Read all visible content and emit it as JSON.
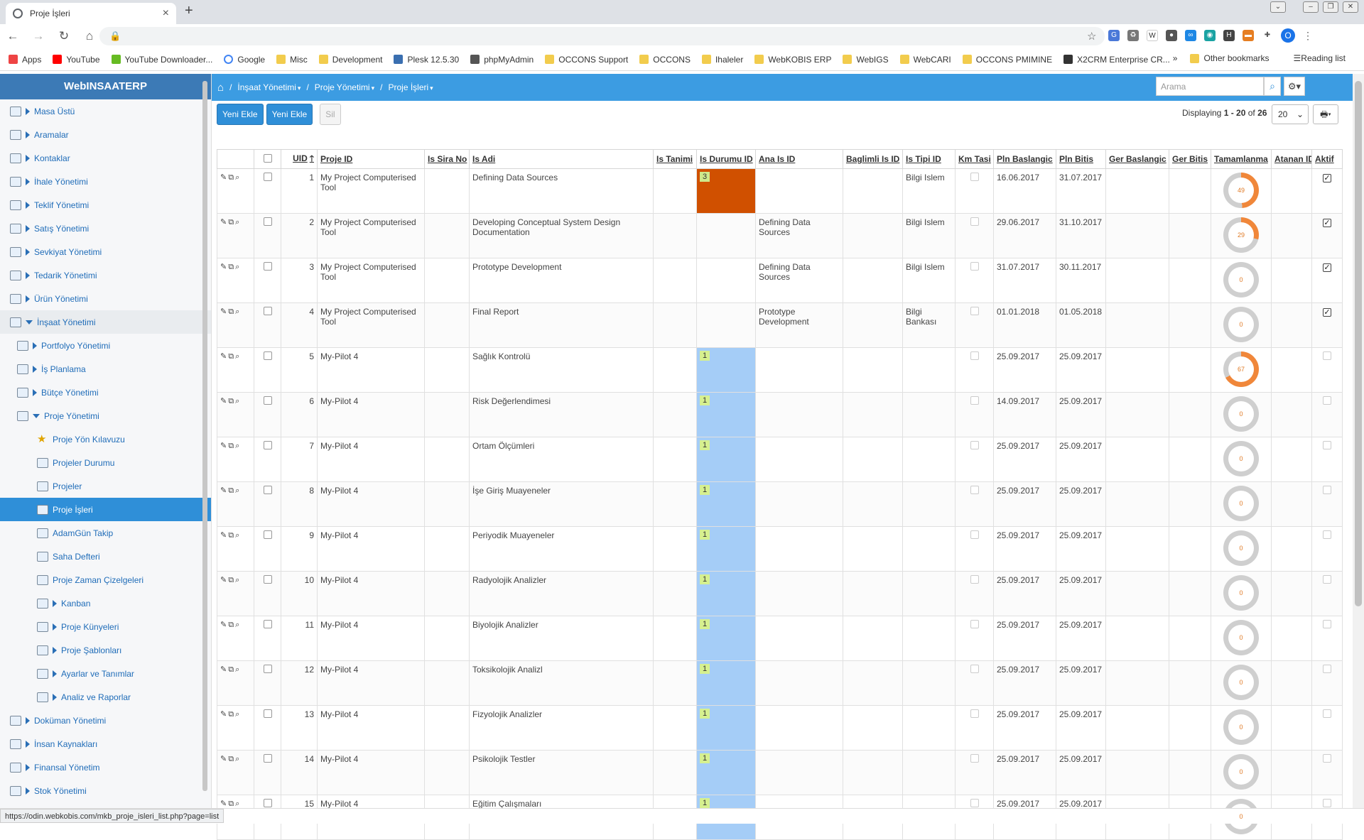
{
  "browser": {
    "tab_title": "Proje İşleri",
    "bookmarks": [
      {
        "label": "Apps",
        "type": "apps"
      },
      {
        "label": "YouTube",
        "type": "youtube"
      },
      {
        "label": "YouTube Downloader...",
        "type": "dl"
      },
      {
        "label": "Google",
        "type": "google"
      },
      {
        "label": "Misc",
        "type": "folder"
      },
      {
        "label": "Development",
        "type": "folder"
      },
      {
        "label": "Plesk 12.5.30",
        "type": "plesk"
      },
      {
        "label": "phpMyAdmin",
        "type": "php"
      },
      {
        "label": "OCCONS Support",
        "type": "folder"
      },
      {
        "label": "OCCONS",
        "type": "folder"
      },
      {
        "label": "Ihaleler",
        "type": "folder"
      },
      {
        "label": "WebKOBIS ERP",
        "type": "folder"
      },
      {
        "label": "WebIGS",
        "type": "folder"
      },
      {
        "label": "WebCARI",
        "type": "folder"
      },
      {
        "label": "OCCONS PMIMINE",
        "type": "folder"
      },
      {
        "label": "X2CRM Enterprise CR...",
        "type": "x2"
      }
    ],
    "more_label": "»",
    "other_bookmarks": "Other bookmarks",
    "reading_list": "Reading list",
    "avatar_letter": "O",
    "status_url": "https://odin.webkobis.com/mkb_proje_isleri_list.php?page=list"
  },
  "app": {
    "brand": "WebINSAATERP",
    "breadcrumb": [
      "İnşaat Yönetimi",
      "Proje Yönetimi",
      "Proje İşleri"
    ],
    "search_placeholder": "Arama",
    "buttons": {
      "add1": "Yeni Ekle",
      "add2": "Yeni Ekle",
      "delete": "Sil"
    },
    "paging": {
      "prefix": "Displaying ",
      "range": "1 - 20",
      "of": " of ",
      "total": "26",
      "page_size": "20"
    }
  },
  "sidebar": [
    {
      "label": "Masa Üstü",
      "level": 0,
      "caret": "right"
    },
    {
      "label": "Aramalar",
      "level": 0,
      "caret": "right"
    },
    {
      "label": "Kontaklar",
      "level": 0,
      "caret": "right"
    },
    {
      "label": "İhale Yönetimi",
      "level": 0,
      "caret": "right"
    },
    {
      "label": "Teklif Yönetimi",
      "level": 0,
      "caret": "right"
    },
    {
      "label": "Satış Yönetimi",
      "level": 0,
      "caret": "right"
    },
    {
      "label": "Sevkiyat Yönetimi",
      "level": 0,
      "caret": "right"
    },
    {
      "label": "Tedarik Yönetimi",
      "level": 0,
      "caret": "right"
    },
    {
      "label": "Ürün Yönetimi",
      "level": 0,
      "caret": "right"
    },
    {
      "label": "İnşaat Yönetimi",
      "level": 0,
      "caret": "down",
      "open": true
    },
    {
      "label": "Portfolyo Yönetimi",
      "level": 1,
      "caret": "right"
    },
    {
      "label": "İş Planlama",
      "level": 1,
      "caret": "right"
    },
    {
      "label": "Bütçe Yönetimi",
      "level": 1,
      "caret": "right"
    },
    {
      "label": "Proje Yönetimi",
      "level": 1,
      "caret": "down"
    },
    {
      "label": "Proje Yön Kılavuzu",
      "level": 2,
      "caret": "none",
      "icon": "star"
    },
    {
      "label": "Projeler Durumu",
      "level": 2,
      "caret": "none"
    },
    {
      "label": "Projeler",
      "level": 2,
      "caret": "none"
    },
    {
      "label": "Proje İşleri",
      "level": 2,
      "caret": "none",
      "active": true
    },
    {
      "label": "AdamGün Takip",
      "level": 2,
      "caret": "none"
    },
    {
      "label": "Saha Defteri",
      "level": 2,
      "caret": "none"
    },
    {
      "label": "Proje Zaman Çizelgeleri",
      "level": 2,
      "caret": "none"
    },
    {
      "label": "Kanban",
      "level": 2,
      "caret": "right"
    },
    {
      "label": "Proje Künyeleri",
      "level": 2,
      "caret": "right"
    },
    {
      "label": "Proje Şablonları",
      "level": 2,
      "caret": "right"
    },
    {
      "label": "Ayarlar ve Tanımlar",
      "level": 2,
      "caret": "right"
    },
    {
      "label": "Analiz ve Raporlar",
      "level": 2,
      "caret": "right"
    },
    {
      "label": "Doküman Yönetimi",
      "level": 0,
      "caret": "right"
    },
    {
      "label": "İnsan Kaynakları",
      "level": 0,
      "caret": "right"
    },
    {
      "label": "Finansal Yönetim",
      "level": 0,
      "caret": "right"
    },
    {
      "label": "Stok Yönetimi",
      "level": 0,
      "caret": "right"
    }
  ],
  "table": {
    "columns": [
      "UID",
      "Proje ID",
      "Is Sira No",
      "Is Adi",
      "Is Tanimi",
      "Is Durumu ID",
      "Ana Is ID",
      "Baglimli Is ID",
      "Is Tipi ID",
      "Km Tasi",
      "Pln Baslangic",
      "Pln Bitis",
      "Ger Baslangic",
      "Ger Bitis",
      "Tamamlanma",
      "Atanan ID",
      "Aktif"
    ],
    "sort_indicator": "🡑",
    "rows": [
      {
        "uid": "1",
        "proje": "My Project Computerised Tool",
        "sira": "",
        "adi": "Defining Data Sources",
        "tanimi": "",
        "durum": "3",
        "durum_color": "#d05000",
        "chip_color": "#cfe88b",
        "ana": "",
        "bagli": "",
        "tip": "Bilgi Islem",
        "km": false,
        "pln_bas": "16.06.2017",
        "pln_bit": "31.07.2017",
        "ger_bas": "",
        "ger_bit": "",
        "pct": 49,
        "atanan": "",
        "aktif": true
      },
      {
        "uid": "2",
        "proje": "My Project Computerised Tool",
        "sira": "",
        "adi": "Developing Conceptual System Design Documentation",
        "tanimi": "",
        "durum": "",
        "durum_color": "",
        "chip_color": "",
        "ana": "Defining Data Sources",
        "bagli": "",
        "tip": "Bilgi Islem",
        "km": false,
        "pln_bas": "29.06.2017",
        "pln_bit": "31.10.2017",
        "ger_bas": "",
        "ger_bit": "",
        "pct": 29,
        "atanan": "",
        "aktif": true
      },
      {
        "uid": "3",
        "proje": "My Project Computerised Tool",
        "sira": "",
        "adi": "Prototype Development",
        "tanimi": "",
        "durum": "",
        "durum_color": "",
        "chip_color": "",
        "ana": "Defining Data Sources",
        "bagli": "",
        "tip": "Bilgi Islem",
        "km": false,
        "pln_bas": "31.07.2017",
        "pln_bit": "30.11.2017",
        "ger_bas": "",
        "ger_bit": "",
        "pct": 0,
        "atanan": "",
        "aktif": true
      },
      {
        "uid": "4",
        "proje": "My Project Computerised Tool",
        "sira": "",
        "adi": "Final Report",
        "tanimi": "",
        "durum": "",
        "durum_color": "",
        "chip_color": "",
        "ana": "Prototype Development",
        "bagli": "",
        "tip": "Bilgi Bankası",
        "km": false,
        "pln_bas": "01.01.2018",
        "pln_bit": "01.05.2018",
        "ger_bas": "",
        "ger_bit": "",
        "pct": 0,
        "atanan": "",
        "aktif": true
      },
      {
        "uid": "5",
        "proje": "My-Pilot 4",
        "sira": "",
        "adi": "Sağlık Kontrolü",
        "tanimi": "",
        "durum": "1",
        "durum_color": "#a5cdf7",
        "chip_color": "#d6f08f",
        "ana": "",
        "bagli": "",
        "tip": "",
        "km": false,
        "pln_bas": "25.09.2017",
        "pln_bit": "25.09.2017",
        "ger_bas": "",
        "ger_bit": "",
        "pct": 67,
        "atanan": "",
        "aktif": false
      },
      {
        "uid": "6",
        "proje": "My-Pilot 4",
        "sira": "",
        "adi": "Risk Değerlendimesi",
        "tanimi": "",
        "durum": "1",
        "durum_color": "#a5cdf7",
        "chip_color": "#d6f08f",
        "ana": "",
        "bagli": "",
        "tip": "",
        "km": false,
        "pln_bas": "14.09.2017",
        "pln_bit": "25.09.2017",
        "ger_bas": "",
        "ger_bit": "",
        "pct": 0,
        "atanan": "",
        "aktif": false
      },
      {
        "uid": "7",
        "proje": "My-Pilot 4",
        "sira": "",
        "adi": "Ortam Ölçümleri",
        "tanimi": "",
        "durum": "1",
        "durum_color": "#a5cdf7",
        "chip_color": "#d6f08f",
        "ana": "",
        "bagli": "",
        "tip": "",
        "km": false,
        "pln_bas": "25.09.2017",
        "pln_bit": "25.09.2017",
        "ger_bas": "",
        "ger_bit": "",
        "pct": 0,
        "atanan": "",
        "aktif": false
      },
      {
        "uid": "8",
        "proje": "My-Pilot 4",
        "sira": "",
        "adi": "İşe Giriş Muayeneler",
        "tanimi": "",
        "durum": "1",
        "durum_color": "#a5cdf7",
        "chip_color": "#d6f08f",
        "ana": "",
        "bagli": "",
        "tip": "",
        "km": false,
        "pln_bas": "25.09.2017",
        "pln_bit": "25.09.2017",
        "ger_bas": "",
        "ger_bit": "",
        "pct": 0,
        "atanan": "",
        "aktif": false
      },
      {
        "uid": "9",
        "proje": "My-Pilot 4",
        "sira": "",
        "adi": "Periyodik Muayeneler",
        "tanimi": "",
        "durum": "1",
        "durum_color": "#a5cdf7",
        "chip_color": "#d6f08f",
        "ana": "",
        "bagli": "",
        "tip": "",
        "km": false,
        "pln_bas": "25.09.2017",
        "pln_bit": "25.09.2017",
        "ger_bas": "",
        "ger_bit": "",
        "pct": 0,
        "atanan": "",
        "aktif": false
      },
      {
        "uid": "10",
        "proje": "My-Pilot 4",
        "sira": "",
        "adi": "Radyolojik Analizler",
        "tanimi": "",
        "durum": "1",
        "durum_color": "#a5cdf7",
        "chip_color": "#d6f08f",
        "ana": "",
        "bagli": "",
        "tip": "",
        "km": false,
        "pln_bas": "25.09.2017",
        "pln_bit": "25.09.2017",
        "ger_bas": "",
        "ger_bit": "",
        "pct": 0,
        "atanan": "",
        "aktif": false
      },
      {
        "uid": "11",
        "proje": "My-Pilot 4",
        "sira": "",
        "adi": "Biyolojik Analizler",
        "tanimi": "",
        "durum": "1",
        "durum_color": "#a5cdf7",
        "chip_color": "#d6f08f",
        "ana": "",
        "bagli": "",
        "tip": "",
        "km": false,
        "pln_bas": "25.09.2017",
        "pln_bit": "25.09.2017",
        "ger_bas": "",
        "ger_bit": "",
        "pct": 0,
        "atanan": "",
        "aktif": false
      },
      {
        "uid": "12",
        "proje": "My-Pilot 4",
        "sira": "",
        "adi": "Toksikolojik Analizl",
        "tanimi": "",
        "durum": "1",
        "durum_color": "#a5cdf7",
        "chip_color": "#d6f08f",
        "ana": "",
        "bagli": "",
        "tip": "",
        "km": false,
        "pln_bas": "25.09.2017",
        "pln_bit": "25.09.2017",
        "ger_bas": "",
        "ger_bit": "",
        "pct": 0,
        "atanan": "",
        "aktif": false
      },
      {
        "uid": "13",
        "proje": "My-Pilot 4",
        "sira": "",
        "adi": "Fizyolojik Analizler",
        "tanimi": "",
        "durum": "1",
        "durum_color": "#a5cdf7",
        "chip_color": "#d6f08f",
        "ana": "",
        "bagli": "",
        "tip": "",
        "km": false,
        "pln_bas": "25.09.2017",
        "pln_bit": "25.09.2017",
        "ger_bas": "",
        "ger_bit": "",
        "pct": 0,
        "atanan": "",
        "aktif": false
      },
      {
        "uid": "14",
        "proje": "My-Pilot 4",
        "sira": "",
        "adi": "Psikolojik Testler",
        "tanimi": "",
        "durum": "1",
        "durum_color": "#a5cdf7",
        "chip_color": "#d6f08f",
        "ana": "",
        "bagli": "",
        "tip": "",
        "km": false,
        "pln_bas": "25.09.2017",
        "pln_bit": "25.09.2017",
        "ger_bas": "",
        "ger_bit": "",
        "pct": 0,
        "atanan": "",
        "aktif": false
      },
      {
        "uid": "15",
        "proje": "My-Pilot 4",
        "sira": "",
        "adi": "Eğitim Çalışmaları",
        "tanimi": "",
        "durum": "1",
        "durum_color": "#a5cdf7",
        "chip_color": "#d6f08f",
        "ana": "",
        "bagli": "",
        "tip": "",
        "km": false,
        "pln_bas": "25.09.2017",
        "pln_bit": "25.09.2017",
        "ger_bas": "",
        "ger_bit": "",
        "pct": 0,
        "atanan": "",
        "aktif": false
      }
    ]
  },
  "colors": {
    "accent": "#3c9ce2",
    "brand_bg": "#3c7ab6",
    "donut_fill": "#f0873a",
    "donut_track": "#cfcfcf"
  }
}
